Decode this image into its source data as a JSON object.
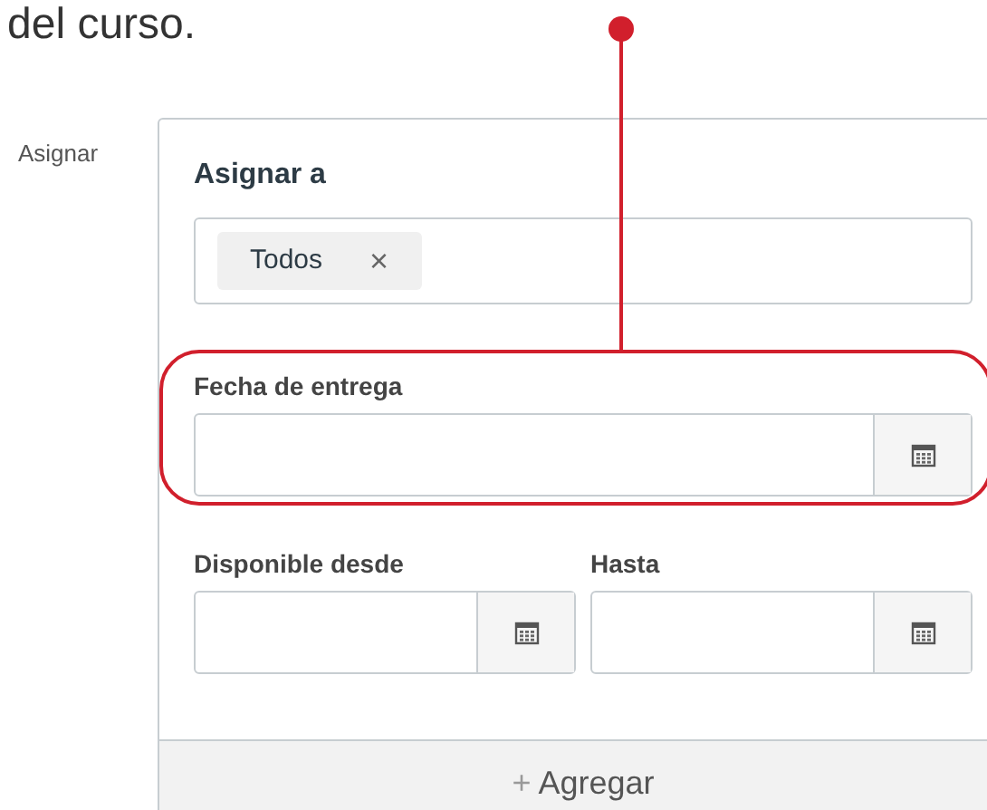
{
  "intro_text": "del curso.",
  "side_label": "Asignar",
  "assign": {
    "title": "Asignar a",
    "tokens": [
      {
        "label": "Todos",
        "remove": "×"
      }
    ]
  },
  "due_date": {
    "label": "Fecha de entrega"
  },
  "range": [
    {
      "label": "Disponible desde"
    },
    {
      "label": "Hasta"
    }
  ],
  "add_button": {
    "icon": "+",
    "label": "Agregar"
  }
}
